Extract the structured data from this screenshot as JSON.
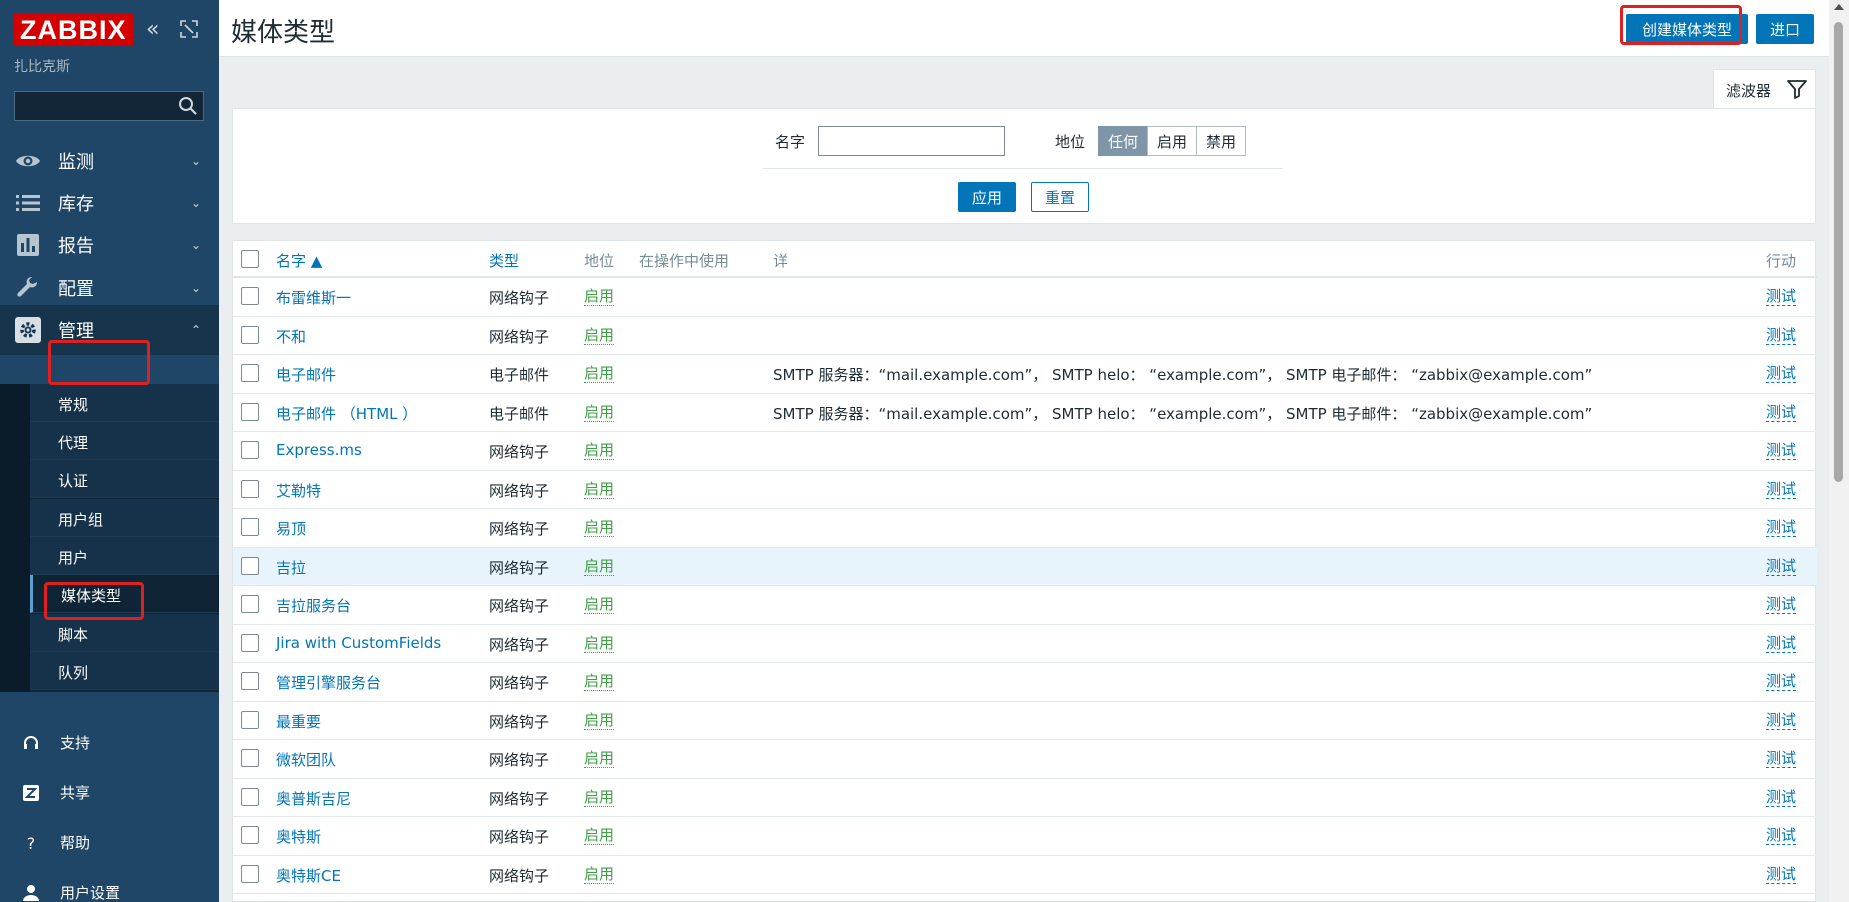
{
  "sidebar": {
    "logo": "ZABBIX",
    "subtitle": "扎比克斯",
    "search_placeholder": "",
    "nav": [
      {
        "label": "监测",
        "icon": "eye-icon"
      },
      {
        "label": "库存",
        "icon": "list-icon"
      },
      {
        "label": "报告",
        "icon": "bar-chart-icon"
      },
      {
        "label": "配置",
        "icon": "wrench-icon"
      },
      {
        "label": "管理",
        "icon": "gear-icon"
      }
    ],
    "admin_submenu": [
      "常规",
      "代理",
      "认证",
      "用户组",
      "用户",
      "媒体类型",
      "脚本",
      "队列"
    ],
    "bottom": [
      {
        "label": "支持",
        "icon": "headset-icon"
      },
      {
        "label": "共享",
        "icon": "z-share-icon"
      },
      {
        "label": "帮助",
        "icon": "question-icon"
      },
      {
        "label": "用户设置",
        "icon": "user-icon"
      }
    ]
  },
  "header": {
    "title": "媒体类型",
    "create_label": "创建媒体类型",
    "import_label": "进口"
  },
  "filter": {
    "tab_label": "滤波器",
    "name_label": "名字",
    "name_value": "",
    "status_label": "地位",
    "status_options": [
      "任何",
      "启用",
      "禁用"
    ],
    "status_selected": "任何",
    "apply_label": "应用",
    "reset_label": "重置"
  },
  "table": {
    "headers": {
      "name": "名字 ▲",
      "type": "类型",
      "status": "地位",
      "used_in_actions": "在操作中使用",
      "details": "详",
      "action": "行动"
    },
    "rows": [
      {
        "name": "布雷维斯一",
        "type": "网络钩子",
        "status": "启用",
        "details": "",
        "action": "测试"
      },
      {
        "name": "不和",
        "type": "网络钩子",
        "status": "启用",
        "details": "",
        "action": "测试"
      },
      {
        "name": "电子邮件",
        "type": "电子邮件",
        "status": "启用",
        "details": "SMTP 服务器：“mail.example.com”， SMTP helo： “example.com”， SMTP 电子邮件： “zabbix@example.com”",
        "action": "测试"
      },
      {
        "name": "电子邮件 （HTML ）",
        "type": "电子邮件",
        "status": "启用",
        "details": "SMTP 服务器：“mail.example.com”， SMTP helo： “example.com”， SMTP 电子邮件： “zabbix@example.com”",
        "action": "测试"
      },
      {
        "name": "Express.ms",
        "type": "网络钩子",
        "status": "启用",
        "details": "",
        "action": "测试"
      },
      {
        "name": "艾勒特",
        "type": "网络钩子",
        "status": "启用",
        "details": "",
        "action": "测试"
      },
      {
        "name": "易顶",
        "type": "网络钩子",
        "status": "启用",
        "details": "",
        "action": "测试"
      },
      {
        "name": "吉拉",
        "type": "网络钩子",
        "status": "启用",
        "details": "",
        "action": "测试"
      },
      {
        "name": "吉拉服务台",
        "type": "网络钩子",
        "status": "启用",
        "details": "",
        "action": "测试"
      },
      {
        "name": "Jira with CustomFields",
        "type": "网络钩子",
        "status": "启用",
        "details": "",
        "action": "测试"
      },
      {
        "name": "管理引擎服务台",
        "type": "网络钩子",
        "status": "启用",
        "details": "",
        "action": "测试"
      },
      {
        "name": "最重要",
        "type": "网络钩子",
        "status": "启用",
        "details": "",
        "action": "测试"
      },
      {
        "name": "微软团队",
        "type": "网络钩子",
        "status": "启用",
        "details": "",
        "action": "测试"
      },
      {
        "name": "奥普斯吉尼",
        "type": "网络钩子",
        "status": "启用",
        "details": "",
        "action": "测试"
      },
      {
        "name": "奥特斯",
        "type": "网络钩子",
        "status": "启用",
        "details": "",
        "action": "测试"
      },
      {
        "name": "奥特斯CE",
        "type": "网络钩子",
        "status": "启用",
        "details": "",
        "action": "测试"
      }
    ]
  },
  "colors": {
    "accent": "#0275b8",
    "sidebar": "#1f4666",
    "enabled": "#429e47",
    "highlight_box": "#e02020"
  }
}
